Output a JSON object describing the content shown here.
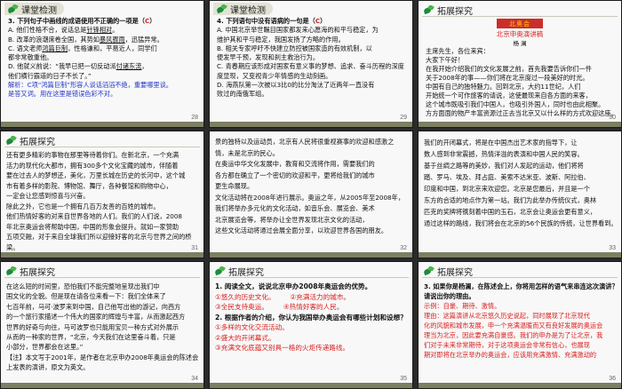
{
  "slides": [
    {
      "num": "28",
      "header": "课堂检测",
      "question": "3. 下列句子中画线的成语使用不正确的一项是（",
      "answer": "C",
      "question_end": "）",
      "a_pre": "A. 他们性格不合，说话总是",
      "a_u": "针锋相对",
      "a_post": "。",
      "b_pre": "B. 改革的浪潮席卷全国，其势如",
      "b_u": "暴风骤雨",
      "b_post": "，迅猛异常。",
      "c_pre": "C. 语文老师",
      "c_u": "鸿篇巨制",
      "c_post": "，性格谦和，平易近人，同学们",
      "c2": "都非常敬重他。",
      "d_pre": "D. 他就义前说：“我早已把一切反动派",
      "d_u": "付诸东流",
      "d_post": "，",
      "d2": "他们横行霸道的日子不长了。”",
      "exp1": "解析：C项“鸿篇巨制”形容人谈话滔滔不绝，重要哪里谈。",
      "exp2": "是答又词。用在这里是错误色彩不对。"
    },
    {
      "num": "29",
      "header": "课堂检测",
      "question": "4. 下列语句中没有语病的一句是（",
      "answer": "C",
      "question_end": "）",
      "lines": [
        "A. 中国北京举世瞩目国家都发来心愿海的和平与稳定，为",
        "维护其和平与稳定，我国发扬了方略的作用。",
        "B. 相关专家呼吁不快建立防控被国家造的有效机制，以",
        "便发早千预，发现和刹主救治行为。",
        "C. 青春期应该形成对国家有意义事的梦想、追求、奋斗历程的深度",
        "度显现，又变视青少年情感的生动刻画。",
        "D. 海燕队第一次被以3比0的比分淘汰了近两年一直没有",
        "败过的南俄军组。"
      ]
    },
    {
      "num": "30",
      "header": "拓展探究",
      "logo_pre": "北",
      "logo_mid": "奥",
      "logo_post": "会",
      "title": "北京申奥演讲稿",
      "author": "杨 澜",
      "lines": [
        "主席先生，各位来宾：",
        "        大家下午好！",
        "        在我开始介绍我们的文化发展之前，首先我要告诉你们一件",
        "关于2008年的事——你们将在北京度过一段美好的时光。",
        "        中国有自己的独特魅力。回到北京，大约11世纪，人们",
        "开始统一个可作旅客的请说，这使最现来自各方面的来客，",
        "这个城市既吸引我们中国人，也吸引外国人，同时也由此相聚。",
        "方方面面的物产丰富资源过正去当北京又以什么样的方式欢迎这座。"
      ]
    },
    {
      "num": "31",
      "header": "拓展探究",
      "lines": [
        "        还有更多精彩的事物在那里等待着你们。在新北京，一个充满",
        "活力的现代化大都市，拥有300多个文化宝藏的城市，伴随着",
        "要在过去人的梦想还，美化，万里长城在历史的长河中，这个城",
        "市有着多样的影院、博物馆、舞厅，各种餐馆和购物中心，",
        "一定会让您感到惊喜与兴奋。",
        "        除此之外，它也是一个拥有几百万友善的百姓的城市。",
        "他们热情好客的对来自世界各地的人们。我们的人们说，2008",
        "年北京奥运会将帮助中国，中国的形象会提升。就如一家赞助",
        "五项交融，对于来自全球我们所以迎接好客的北京与世界之间的桥梁。"
      ]
    },
    {
      "num": "32",
      "lines": [
        "        景的独特以及运动员，北京有人民将很重视赛事的欢迎和感激之",
        "情，未是北京的民心。",
        "        在奥运中华文化发展中，教育和交流将作用，需要我们的",
        "各方都在确立了一个密切的欢迎和平，更将给我们的城市",
        "更生命展现。",
        "        文化活动将在2008年进行展示。奥运之年，从2005年至2008年，",
        "我们将举办多元化的文化活动，如音乐会、展览会、美术",
        "北京展览会等，将举办让全世界发现北京文化的活动，",
        "这些文化活动将通过会展全面分享，以欢迎世界各国的朋友。"
      ]
    },
    {
      "num": "33",
      "lines": [
        "        我们的开闭幕式，将是在中国杰出艺术家的指导下，让",
        "数人感到非常震撼，热情洋溢的表演和中国人民的笑容。",
        "        基于丝绸之路等的美妙，我们对人发起的运动，他们将将",
        "踏、罗马、埃及、拜占庭、美索不达米亚、波斯、阿拉伯、",
        "印度和中国，到北京来欢迎您。北京是您最后，并且是一个",
        "东方的合适的地点作为第一站。我们为此举办传统仪式，奥林",
        "匹克的奖牌将镌刻着中国的玉石，北京会让奥运会更有意义，",
        "通过这样的路线，我们将会在北京的56个民族的传统，让世界看到。"
      ]
    },
    {
      "num": "34",
      "header": "拓展探究",
      "lines": [
        "        在这么短的时间里，恐怕我们不能完整地呈现出我们中",
        "国文化的全貌。但是现在请各位来看一下：我们全体来了",
        "七百年前，马可·波罗来到中国，自己他写出他的游记，向西方",
        "的一个旅行家描述一个伟大的国家的辉煌与丰富，从而激起西方",
        "世界的好奇与向往，马可波罗也只能用宝贝一种方式对外展示",
        "从而的一种家的世界，“北京，今天我们在这里奋斗着，只是",
        "小部分，世界都会在这里。”"
      ],
      "note": "【注】本文写于2001年，是作者在北京申办2008年奥运会的陈述会上发表的演讲，原文为英文。"
    },
    {
      "num": "35",
      "header": "拓展探究",
      "q1": "1. 阅读全文，说说北京申办2008年奥运会的优势。",
      "a1_1": "①悠久的历史文化。",
      "a1_2": "②充满活力的城市。",
      "a1_3": "③全民支持奥运。",
      "a1_4": "④热情好客的人民。",
      "q2": "2. 根据作者的介绍，你认为我国举办奥运会有哪些计划和设想？",
      "a2_1": "①多样的文化交流活动。",
      "a2_2": "②盛大的开闭幕式。",
      "a2_3": "③充满文化底蕴又别具一格的火炬传递路线。"
    },
    {
      "num": "36",
      "header": "拓展探究",
      "q": "3. 如果你是杨澜，在陈述会上，你将用怎样的语气来串连这次演讲？请说出你的理由。",
      "a": "示例：自豪、期待、激情。",
      "r1": "理由：这篇演讲从北京悠久历史说起，同时展现了北京现代",
      "r2": "化的风貌和城市发展，申一个充满温暖而又有良好发展的奥运会",
      "r3": "理当为北京，因此要充满自豪感。我们的申办是为了让北京，我",
      "r4": "们对于未来非常期待，对于这项奥运会非常有信心，也展现",
      "r5": "期对即将在北京举办的奥运会，应该用充满激情、充满激动的"
    }
  ]
}
